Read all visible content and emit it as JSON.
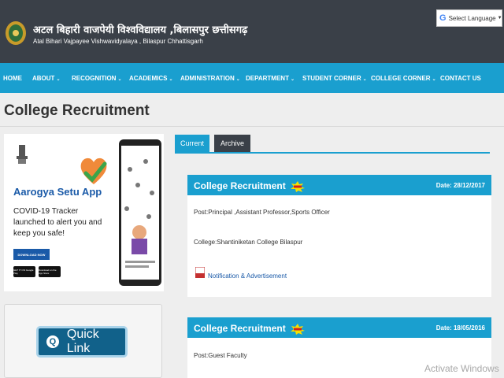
{
  "header": {
    "title_hindi": "अटल बिहारी वाजपेयी विश्वविद्यालय ,बिलासपुर छत्तीसगढ़",
    "title_english": "Atal Bihari Vajpayee Vishwavidyalaya , Bilaspur Chhattisgarh",
    "language_selector": "Select Language"
  },
  "nav": {
    "items": [
      {
        "label": "HOME"
      },
      {
        "label": "ABOUT"
      },
      {
        "label": "RECOGNITION"
      },
      {
        "label": "ACADEMICS"
      },
      {
        "label": "ADMINISTRATION"
      },
      {
        "label": "DEPARTMENT"
      },
      {
        "label": "STUDENT CORNER"
      },
      {
        "label": "COLLEGE CORNER"
      },
      {
        "label": "CONTACT US"
      }
    ]
  },
  "page": {
    "title": "College Recruitment"
  },
  "banner": {
    "headline": "Aarogya Setu App",
    "text": "COVID-19 Tracker launched to alert you and keep you safe!",
    "download": "DOWNLOAD NOW",
    "store_google": "GET IT ON Google Play",
    "store_apple": "Download on the App Store"
  },
  "quick_link": {
    "label": "Quick Link"
  },
  "tabs": [
    {
      "label": "Current",
      "active": true
    },
    {
      "label": "Archive",
      "active": false
    }
  ],
  "cards": [
    {
      "title": "College Recruitment",
      "date": "Date: 28/12/2017",
      "post": "Post:Principal ,Assistant Professor,Sports Officer",
      "college": "College:Shantiniketan College Bilaspur",
      "link": "Notification & Advertisement"
    },
    {
      "title": "College Recruitment",
      "date": "Date: 18/05/2016",
      "post": "Post:Guest Faculty"
    }
  ],
  "watermark": "Activate Windows",
  "colors": {
    "accent": "#1a9fcf",
    "header_bg": "#3a4048",
    "button": "#11618a"
  }
}
